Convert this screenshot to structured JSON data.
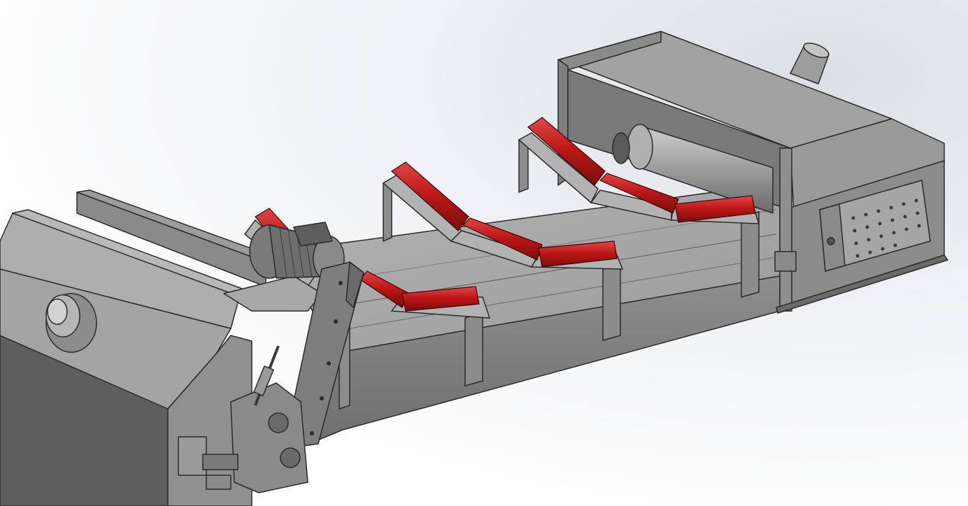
{
  "scene": {
    "subject": "conveyor-assembly",
    "colors": {
      "background": "#ffffff",
      "steel_light": "#a9a9a9",
      "steel_mid": "#8f8f8f",
      "steel_dark": "#6e6e6e",
      "edge": "#2a2a2a",
      "roller": "#c01818",
      "roller_highlight": "#e04848",
      "roller_shadow": "#7a0c0c"
    },
    "counts": {
      "troughing_idler_sets": 4,
      "rollers_per_set": 3
    }
  }
}
